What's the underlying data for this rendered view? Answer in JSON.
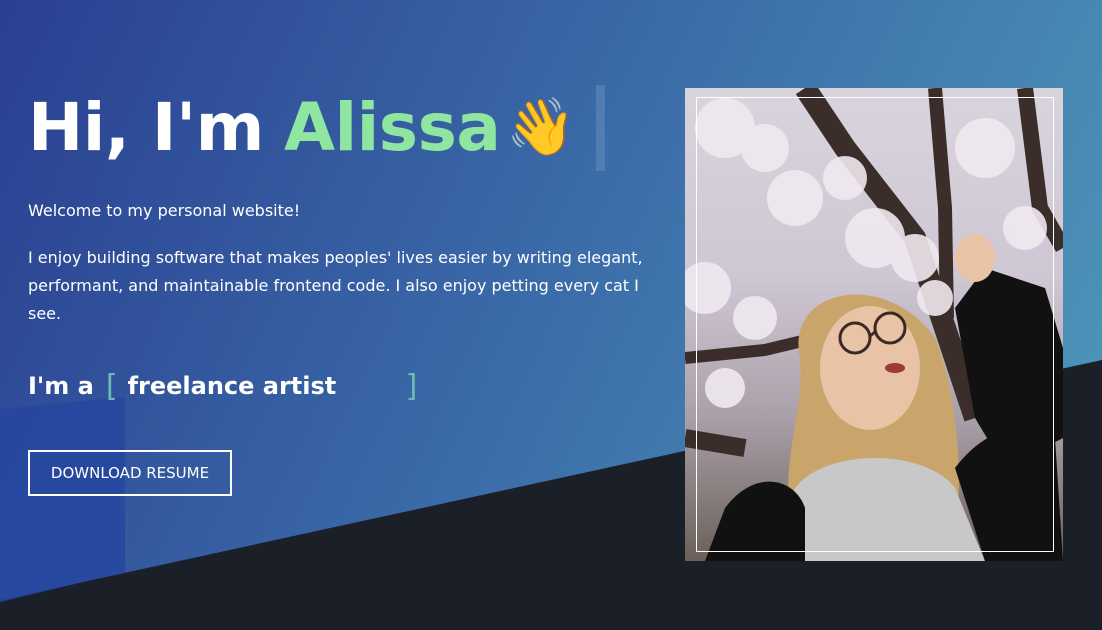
{
  "hero": {
    "greeting": "Hi, I'm",
    "name": "Alissa",
    "wave_emoji": "👋",
    "welcome": "Welcome to my personal website!",
    "bio": "I enjoy building software that makes peoples' lives easier by writing elegant, performant, and maintainable frontend code. I also enjoy petting every cat I see.",
    "role_prefix": "I'm a",
    "bracket_open": "[",
    "role": "freelance artist",
    "bracket_close": "]",
    "resume_button": "DOWNLOAD RESUME"
  },
  "colors": {
    "name_accent": "#8ee6a0",
    "bracket": "#6bbcb0",
    "dark_band": "#1a1f28"
  },
  "icons": {
    "wave": "waving-hand-emoji"
  }
}
